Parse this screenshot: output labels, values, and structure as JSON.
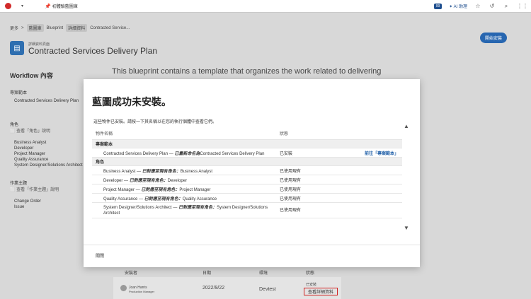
{
  "topbar": {
    "dropdown_glyph": "▾",
    "pin_glyph": "📌",
    "tab_title": "初體驗藍圖庫",
    "badge": "99",
    "ai_label": "AI 助理",
    "icons": [
      "star-icon",
      "history-icon",
      "search-icon",
      "grid-icon"
    ]
  },
  "page": {
    "breadcrumb": [
      "更多",
      ">",
      "藍圖庫",
      "Blueprint",
      "詳細資料",
      "Contracted Service..."
    ],
    "header_kicker": "詳細資料頁面",
    "header_title": "Contracted Services Delivery Plan",
    "install_button": "開始安裝",
    "intro": "This blueprint contains a template that organizes the work related to delivering",
    "sidebar": {
      "title": "Workflow 內容",
      "section1_label": "專案範本",
      "section1_items": [
        "Contracted Services Delivery Plan"
      ],
      "section2_label": "角色",
      "section2_note": "⬜ 查看「角色」說明",
      "section2_items": [
        "Business Analyst",
        "Developer",
        "Project Manager",
        "Quality Assurance",
        "System Designer/Solutions Architect"
      ],
      "section3_label": "作業主題",
      "section3_note": "⬜ 查看「作業主題」說明",
      "section3_items": [
        "Change Order",
        "Issue"
      ]
    },
    "history": {
      "headers": [
        "安裝者",
        "日期",
        "環境",
        "狀態"
      ],
      "installer_name": "Joan Harris",
      "installer_role": "Production Manager",
      "date": "2022/9/22",
      "env": "Devtest",
      "status": "已安裝",
      "details_link": "查看詳細資料"
    }
  },
  "modal": {
    "title": "藍圖成功未安裝。",
    "subtitle": "這些物件已安裝。請按一下其名稱以在您的執行個體中查看它們。",
    "col_name": "物件名稱",
    "col_status": "狀態",
    "groups": [
      {
        "label": "專案範本",
        "rows": [
          {
            "name": "Contracted Services Delivery Plan",
            "note": "已重新命名為",
            "target": "Contracted Services Delivery Plan",
            "status": "已安裝",
            "link": "前往「專案範本」"
          }
        ]
      },
      {
        "label": "角色",
        "rows": [
          {
            "name": "Business Analyst",
            "note": "已對應至現有角色：",
            "target": "Business Analyst",
            "status": "已使用現有"
          },
          {
            "name": "Developer",
            "note": "已對應至現有角色：",
            "target": "Developer",
            "status": "已使用現有"
          },
          {
            "name": "Project Manager",
            "note": "已對應至現有角色：",
            "target": "Project Manager",
            "status": "已使用現有"
          },
          {
            "name": "Quality Assurance",
            "note": "已對應至現有角色：",
            "target": "Quality Assurance",
            "status": "已使用現有"
          },
          {
            "name": "System Designer/Solutions Architect",
            "note": "已對應至現有角色：",
            "target": "System Designer/Solutions Architect",
            "status": "已使用現有"
          }
        ]
      }
    ],
    "close": "關閉"
  }
}
